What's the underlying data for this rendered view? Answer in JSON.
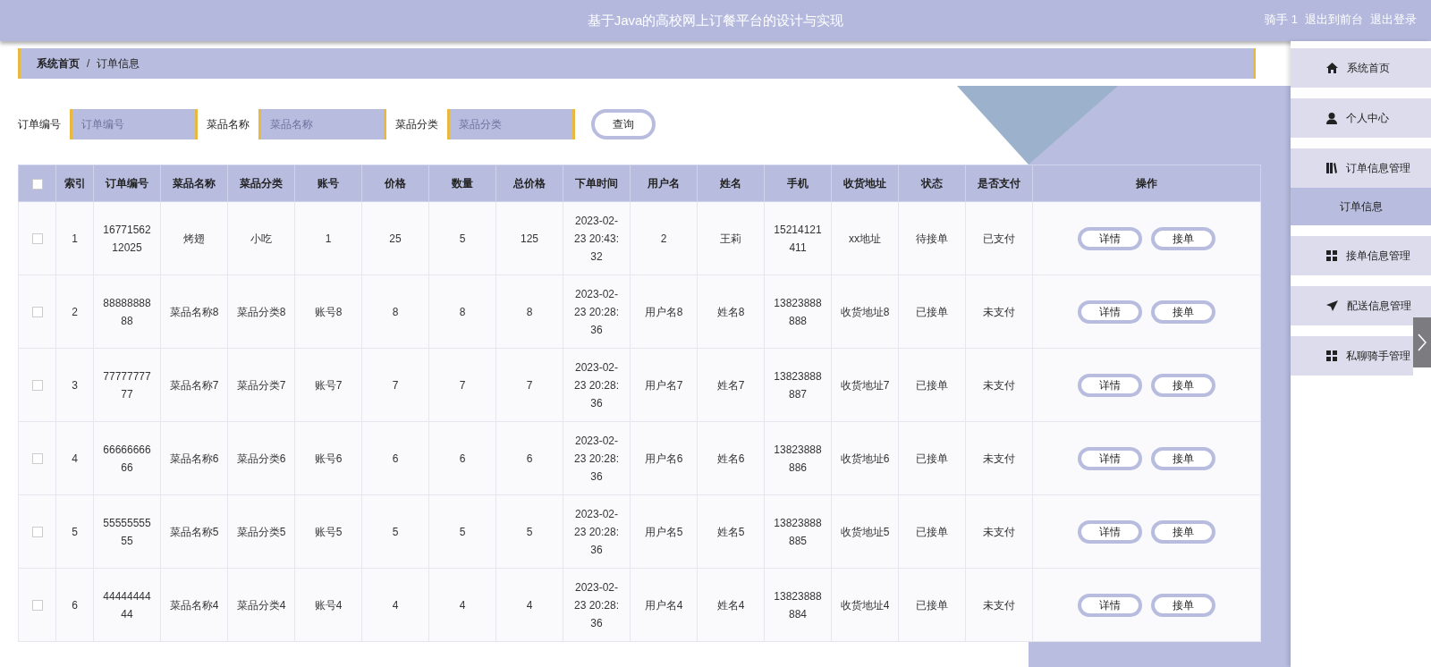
{
  "header": {
    "title": "基于Java的高校网上订餐平台的设计与实现",
    "user_links": [
      "骑手 1",
      "退出到前台",
      "退出登录"
    ]
  },
  "breadcrumb": {
    "items": [
      "系统首页",
      "订单信息"
    ],
    "separator": "/"
  },
  "search": {
    "fields": [
      {
        "label": "订单编号",
        "placeholder": "订单编号"
      },
      {
        "label": "菜品名称",
        "placeholder": "菜品名称"
      },
      {
        "label": "菜品分类",
        "placeholder": "菜品分类"
      }
    ],
    "button": "查询"
  },
  "table": {
    "select_all_checked": false,
    "columns": [
      "索引",
      "订单编号",
      "菜品名称",
      "菜品分类",
      "账号",
      "价格",
      "数量",
      "总价格",
      "下单时间",
      "用户名",
      "姓名",
      "手机",
      "收货地址",
      "状态",
      "是否支付",
      "操作"
    ],
    "rows": [
      {
        "checked": false,
        "cells": [
          "1",
          "1677156212025",
          "烤翅",
          "小吃",
          "1",
          "25",
          "5",
          "125",
          "2023-02-23 20:43:32",
          "2",
          "王莉",
          "15214121411",
          "xx地址",
          "待接单",
          "已支付"
        ],
        "actions": [
          "详情",
          "接单"
        ]
      },
      {
        "checked": false,
        "cells": [
          "2",
          "8888888888",
          "菜品名称8",
          "菜品分类8",
          "账号8",
          "8",
          "8",
          "8",
          "2023-02-23 20:28:36",
          "用户名8",
          "姓名8",
          "13823888888",
          "收货地址8",
          "已接单",
          "未支付"
        ],
        "actions": [
          "详情",
          "接单"
        ]
      },
      {
        "checked": false,
        "cells": [
          "3",
          "7777777777",
          "菜品名称7",
          "菜品分类7",
          "账号7",
          "7",
          "7",
          "7",
          "2023-02-23 20:28:36",
          "用户名7",
          "姓名7",
          "13823888887",
          "收货地址7",
          "已接单",
          "未支付"
        ],
        "actions": [
          "详情",
          "接单"
        ]
      },
      {
        "checked": false,
        "cells": [
          "4",
          "6666666666",
          "菜品名称6",
          "菜品分类6",
          "账号6",
          "6",
          "6",
          "6",
          "2023-02-23 20:28:36",
          "用户名6",
          "姓名6",
          "13823888886",
          "收货地址6",
          "已接单",
          "未支付"
        ],
        "actions": [
          "详情",
          "接单"
        ]
      },
      {
        "checked": false,
        "cells": [
          "5",
          "5555555555",
          "菜品名称5",
          "菜品分类5",
          "账号5",
          "5",
          "5",
          "5",
          "2023-02-23 20:28:36",
          "用户名5",
          "姓名5",
          "13823888885",
          "收货地址5",
          "已接单",
          "未支付"
        ],
        "actions": [
          "详情",
          "接单"
        ]
      },
      {
        "checked": false,
        "cells": [
          "6",
          "4444444444",
          "菜品名称4",
          "菜品分类4",
          "账号4",
          "4",
          "4",
          "4",
          "2023-02-23 20:28:36",
          "用户名4",
          "姓名4",
          "13823888884",
          "收货地址4",
          "已接单",
          "未支付"
        ],
        "actions": [
          "详情",
          "接单"
        ]
      }
    ]
  },
  "sidebar": {
    "items": [
      {
        "label": "系统首页",
        "selected": false
      },
      {
        "label": "个人中心",
        "selected": false
      },
      {
        "label": "订单信息管理",
        "selected": false,
        "expanded": true,
        "children": [
          {
            "label": "订单信息",
            "selected": true
          }
        ]
      },
      {
        "label": "接单信息管理",
        "selected": false
      },
      {
        "label": "配送信息管理",
        "selected": false
      },
      {
        "label": "私聊骑手管理",
        "selected": false
      }
    ]
  }
}
